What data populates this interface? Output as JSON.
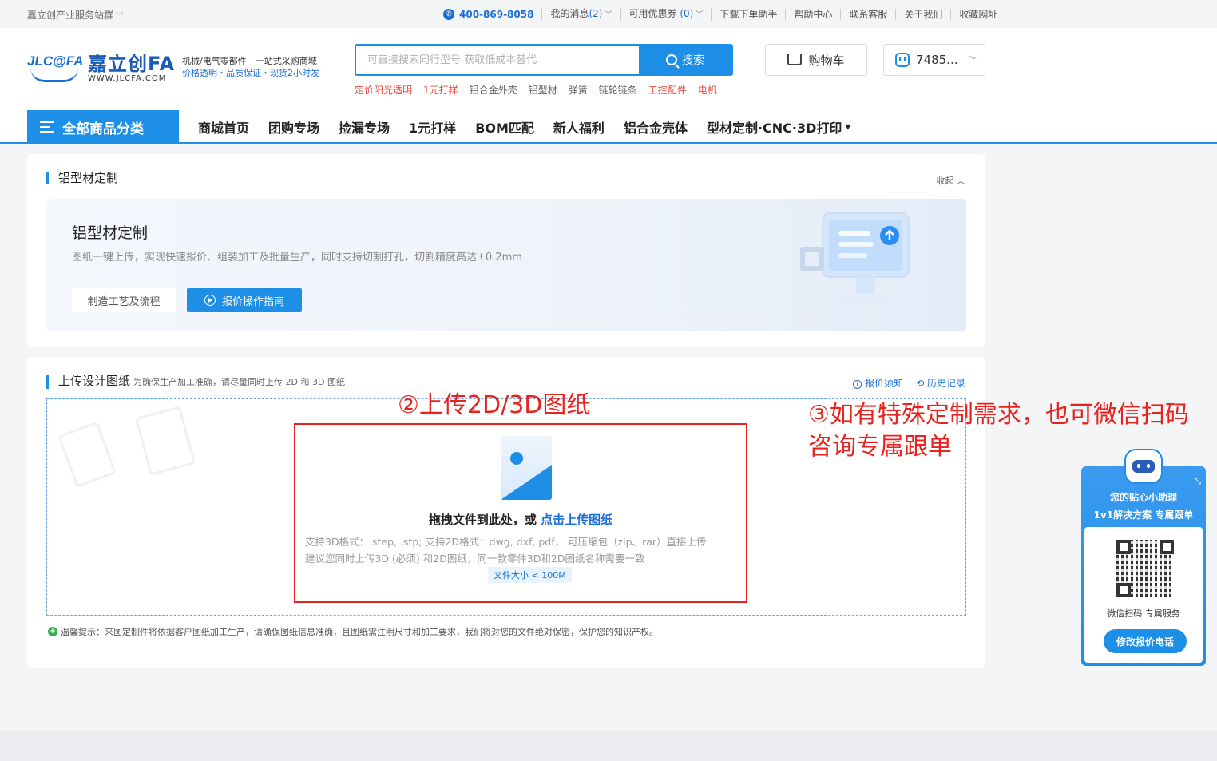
{
  "topbar": {
    "site_group": "嘉立创产业服务站群",
    "phone": "400-869-8058",
    "messages_label": "我的消息",
    "messages_count": "(2)",
    "coupons_label": "可用优惠券",
    "coupons_count": "(0)",
    "download": "下载下单助手",
    "help": "帮助中心",
    "service": "联系客服",
    "about": "关于我们",
    "bookmark": "收藏网址"
  },
  "header": {
    "logo_mark": "JLC@FA",
    "logo_cn": "嘉立创FA",
    "logo_url": "WWW.JLCFA.COM",
    "slogan_line1": "机械/电气零部件　一站式采购商城",
    "slogan_line2": "价格透明・品质保证・现货2小时发",
    "search_placeholder": "可直接搜索同行型号 获取低成本替代",
    "search_button": "搜索",
    "hotwords": [
      {
        "text": "定价阳光透明",
        "red": true
      },
      {
        "text": "1元打样",
        "red": true
      },
      {
        "text": "铝合金外壳",
        "red": false
      },
      {
        "text": "铝型材",
        "red": false
      },
      {
        "text": "弹簧",
        "red": false
      },
      {
        "text": "链轮链条",
        "red": false
      },
      {
        "text": "工控配件",
        "red": true
      },
      {
        "text": "电机",
        "red": true
      }
    ],
    "cart": "购物车",
    "user": "7485..."
  },
  "nav": {
    "all_categories": "全部商品分类",
    "links": [
      "商城首页",
      "团购专场",
      "捡漏专场",
      "1元打样",
      "BOM匹配",
      "新人福利",
      "铝合金壳体",
      "型材定制·CNC·3D打印"
    ]
  },
  "section1": {
    "title": "铝型材定制",
    "collapse": "收起",
    "banner_title": "铝型材定制",
    "banner_desc": "图纸一键上传，实现快速报价、组装加工及批量生产，同时支持切割打孔，切割精度高达±0.2mm",
    "btn_process": "制造工艺及流程",
    "btn_guide": "报价操作指南"
  },
  "section2": {
    "title": "上传设计图纸",
    "subtitle": "为确保生产加工准确，请尽量同时上传 2D 和 3D 图纸",
    "notice_link": "报价须知",
    "history_link": "历史记录",
    "drag_text": "拖拽文件到此处，或",
    "upload_link": "点击上传图纸",
    "formats": "支持3D格式：.step, .stp; 支持2D格式：dwg, dxf, pdf，  可压缩包（zip、rar）直接上传",
    "suggest": "建议您同时上传3D (必须) 和2D图纸，同一款零件3D和2D图纸名称需要一致",
    "size_limit": "文件大小 < 100M",
    "tip": "温馨提示：来图定制件将依据客户图纸加工生产，请确保图纸信息准确，且图纸需注明尺寸和加工要求，我们将对您的文件绝对保密，保护您的知识产权。"
  },
  "annotations": {
    "step2": "②上传2D/3D图纸",
    "step3": "③如有特殊定制需求，也可微信扫码咨询专属跟单"
  },
  "assistant": {
    "title1": "您的贴心小助理",
    "title2": "1v1解决方案 专属跟单",
    "scan": "微信扫码 专属服务",
    "button": "修改报价电话"
  },
  "colors": {
    "primary": "#1d8fe6",
    "annotation_red": "#e8231f",
    "hot_red": "#e94b3c"
  }
}
